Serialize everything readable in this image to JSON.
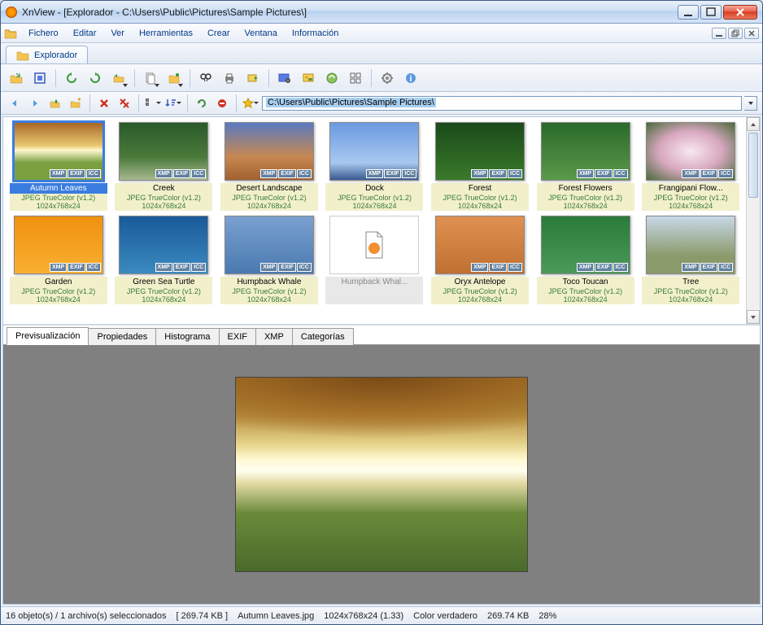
{
  "window": {
    "title": "XnView - [Explorador - C:\\Users\\Public\\Pictures\\Sample Pictures\\]"
  },
  "menu": [
    "Fichero",
    "Editar",
    "Ver",
    "Herramientas",
    "Crear",
    "Ventana",
    "Información"
  ],
  "doc_tab": "Explorador",
  "address": "C:\\Users\\Public\\Pictures\\Sample Pictures\\",
  "thumbs": [
    {
      "name": "Autumn Leaves",
      "info": "JPEG TrueColor (v1.2)",
      "dim": "1024x768x24",
      "selected": true,
      "bg": "linear-gradient(to bottom,#a86828,#e8c870 40%,#fff8d0 48%,#7aa040 70%)"
    },
    {
      "name": "Creek",
      "info": "JPEG TrueColor (v1.2)",
      "dim": "1024x768x24",
      "bg": "linear-gradient(#2a5a2a,#4a7a3a 60%,#a8b890)"
    },
    {
      "name": "Desert Landscape",
      "info": "JPEG TrueColor (v1.2)",
      "dim": "1024x768x24",
      "bg": "linear-gradient(#5a7ac0,#c88850 60%,#a06030)"
    },
    {
      "name": "Dock",
      "info": "JPEG TrueColor (v1.2)",
      "dim": "1024x768x24",
      "bg": "linear-gradient(#6a9ae0,#a8c8f0 70%,#3a5a90)"
    },
    {
      "name": "Forest",
      "info": "JPEG TrueColor (v1.2)",
      "dim": "1024x768x24",
      "bg": "linear-gradient(#1a4a1a,#3a7a2a)"
    },
    {
      "name": "Forest Flowers",
      "info": "JPEG TrueColor (v1.2)",
      "dim": "1024x768x24",
      "bg": "linear-gradient(#2a6a2a,#5a9a4a)"
    },
    {
      "name": "Frangipani Flow...",
      "info": "JPEG TrueColor (v1.2)",
      "dim": "1024x768x24",
      "bg": "radial-gradient(#f8e8f0,#d8a8c0,#4a6a3a)"
    },
    {
      "name": "Garden",
      "info": "JPEG TrueColor (v1.2)",
      "dim": "1024x768x24",
      "bg": "linear-gradient(#f09010,#f8b030)"
    },
    {
      "name": "Green Sea Turtle",
      "info": "JPEG TrueColor (v1.2)",
      "dim": "1024x768x24",
      "bg": "linear-gradient(#1a5a9a,#3a8ac0)"
    },
    {
      "name": "Humpback Whale",
      "info": "JPEG TrueColor (v1.2)",
      "dim": "1024x768x24",
      "bg": "linear-gradient(#7aa0d0,#4a7ab0)"
    },
    {
      "name": "Humpback Whal...",
      "info": "",
      "dim": "",
      "disabled": true,
      "icon": true
    },
    {
      "name": "Oryx Antelope",
      "info": "JPEG TrueColor (v1.2)",
      "dim": "1024x768x24",
      "bg": "linear-gradient(#e09050,#c07030)"
    },
    {
      "name": "Toco Toucan",
      "info": "JPEG TrueColor (v1.2)",
      "dim": "1024x768x24",
      "bg": "linear-gradient(#2a7a3a,#4a9a5a)"
    },
    {
      "name": "Tree",
      "info": "JPEG TrueColor (v1.2)",
      "dim": "1024x768x24",
      "bg": "linear-gradient(#c8d8e8,#8a9a6a 70%)"
    }
  ],
  "badges": [
    "XMP",
    "EXIF",
    "ICC"
  ],
  "panel_tabs": [
    "Previsualización",
    "Propiedades",
    "Histograma",
    "EXIF",
    "XMP",
    "Categorías"
  ],
  "status": {
    "objects": "16 objeto(s) / 1 archivo(s) seleccionados",
    "sel_size": "[ 269.74 KB ]",
    "filename": "Autumn Leaves.jpg",
    "dims": "1024x768x24 (1.33)",
    "color": "Color verdadero",
    "filesize": "269.74 KB",
    "zoom": "28%"
  }
}
